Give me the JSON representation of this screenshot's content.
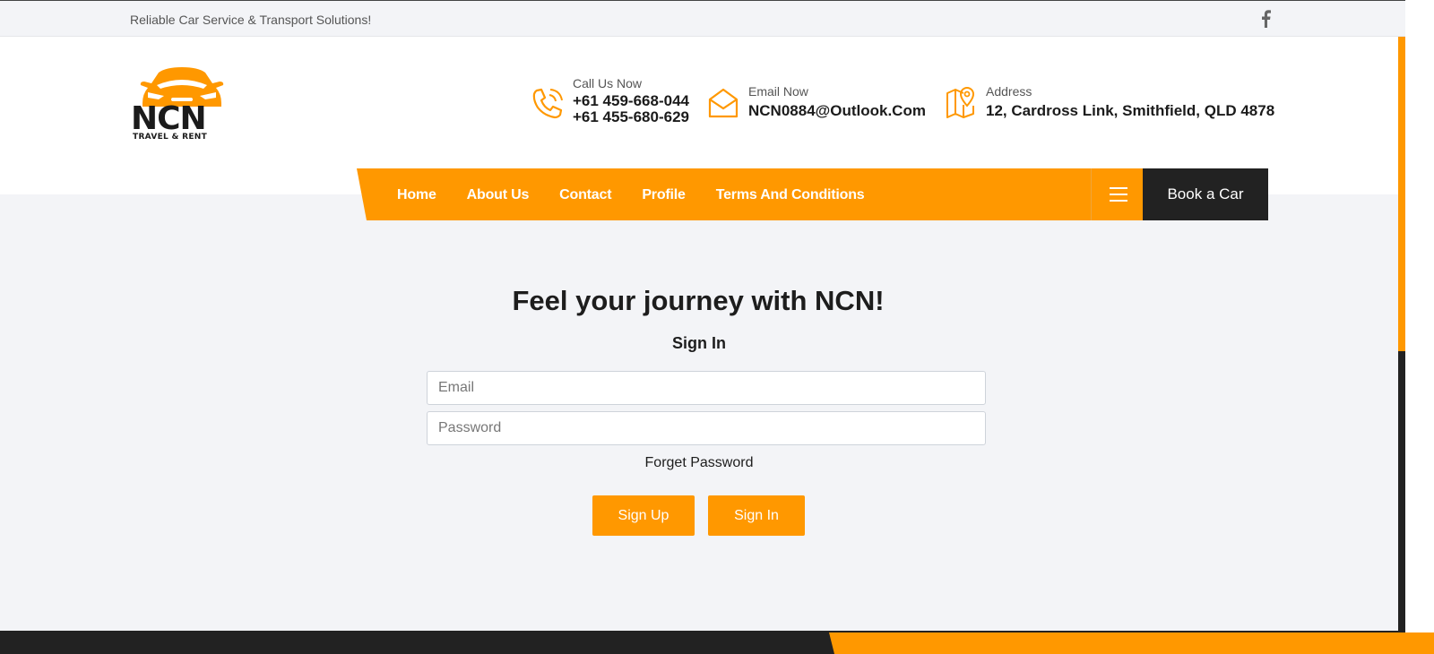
{
  "topbar": {
    "tagline": "Reliable Car Service & Transport Solutions!",
    "social_icon": "facebook-icon"
  },
  "logo": {
    "brand": "NCN",
    "subtitle": "TRAVEL & RENT"
  },
  "contact": {
    "phone": {
      "label": "Call Us Now",
      "line1": "+61 459-668-044",
      "line2": "+61 455-680-629",
      "icon": "phone-icon"
    },
    "email": {
      "label": "Email Now",
      "value": "NCN0884@Outlook.Com",
      "icon": "envelope-icon"
    },
    "address": {
      "label": "Address",
      "value": "12, Cardross Link, Smithfield, QLD 4878",
      "icon": "map-pin-icon"
    }
  },
  "nav": {
    "items": [
      "Home",
      "About Us",
      "Contact",
      "Profile",
      "Terms And Conditions"
    ],
    "menu_icon": "hamburger-icon",
    "cta": "Book a Car"
  },
  "main": {
    "headline": "Feel your journey with NCN!",
    "form_title": "Sign In",
    "email_placeholder": "Email",
    "password_placeholder": "Password",
    "email_value": "",
    "password_value": "",
    "forgot": "Forget Password",
    "signup_button": "Sign Up",
    "signin_button": "Sign In"
  },
  "colors": {
    "accent": "#ff9800",
    "dark": "#222222",
    "background": "#f3f4f7"
  }
}
